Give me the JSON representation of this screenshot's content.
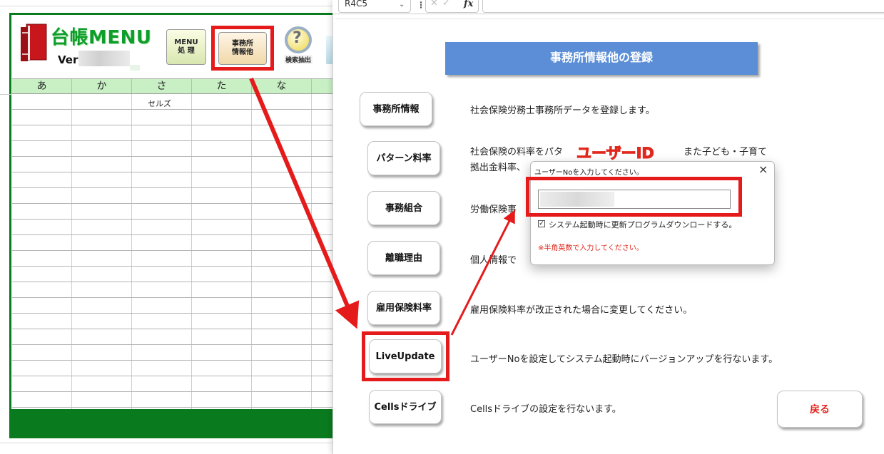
{
  "formula_bar": {
    "name_box": "R4C5",
    "fx_label": "fx"
  },
  "ledger": {
    "title": "台帳MENU",
    "version_label": "Ver",
    "tiles": {
      "menu_line1": "MENU",
      "menu_line2": "処 理",
      "office_line1": "事務所",
      "office_line2": "情報他",
      "search_label": "検索抽出"
    },
    "columns": [
      "あ",
      "か",
      "さ",
      "た",
      "な"
    ],
    "cell_value": "セルズ"
  },
  "form": {
    "title": "事務所情報他の登録",
    "items": [
      {
        "button": "事務所情報",
        "description": "社会保険労務士事務所データを登録します。"
      },
      {
        "button": "パターン料率",
        "description_line1": "社会保険の料率をパタ",
        "description_line1_tail": "また子ども・子育て",
        "description_line2": "拠出金料率、"
      },
      {
        "button": "事務組合",
        "description": "労働保険事"
      },
      {
        "button": "離職理由",
        "description": "個人情報で"
      },
      {
        "button": "雇用保険料率",
        "description": "雇用保険料率が改正された場合に変更してください。"
      },
      {
        "button": "LiveUpdate",
        "description": "ユーザーNoを設定してシステム起動時にバージョンアップを行ないます。"
      },
      {
        "button": "Cellsドライブ",
        "description": "Cellsドライブの設定を行ないます。"
      }
    ],
    "back_button": "戻る"
  },
  "dialog": {
    "title": "ユーザーNoを入力してください。",
    "close_glyph": "×",
    "checkbox_checked": true,
    "checkbox_label": "システム起動時に更新プログラムダウンロードする。",
    "note": "※半角英数で入力してください。"
  },
  "annotation": {
    "text": "ユーザーID",
    "color": "#e0281e"
  },
  "colors": {
    "ledger_green": "#0a7a1f",
    "header_green": "#c8f0c4",
    "form_title_blue": "#5b8ed6",
    "highlight_red": "#e51b1b"
  }
}
